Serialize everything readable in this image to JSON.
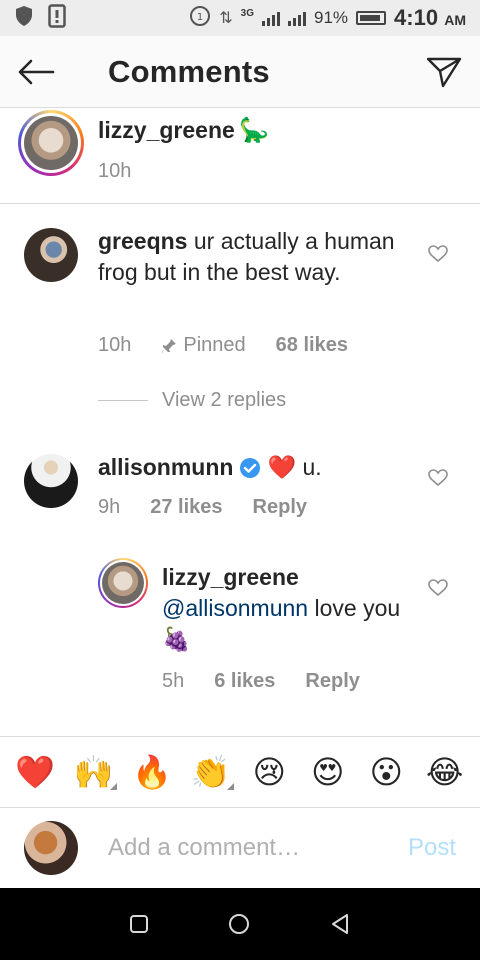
{
  "status_bar": {
    "battery": "91%",
    "time": "4:10",
    "ampm": "AM",
    "network": "3G"
  },
  "header": {
    "title": "Comments"
  },
  "caption": {
    "username": "lizzy_greene",
    "emoji": "🦕",
    "time": "10h"
  },
  "comments": [
    {
      "username": "greeqns",
      "text": " ur actually a human frog but in the best way.",
      "time": "10h",
      "pinned": "Pinned",
      "likes": "68 likes"
    },
    {
      "username": "allisonmunn",
      "text": " ❤️ u.",
      "time": "9h",
      "likes": "27 likes",
      "reply": "Reply"
    },
    {
      "username": "lizzy_greene",
      "mention": "@allisonmunn",
      "text": " love you🍇",
      "time": "5h",
      "likes": "6 likes",
      "reply": "Reply"
    }
  ],
  "view_replies": "View 2 replies",
  "emoji_bar": [
    "❤️",
    "🙌",
    "🔥",
    "👏",
    "😢",
    "😍",
    "😮",
    "😂"
  ],
  "composer": {
    "placeholder": "Add a comment…",
    "post": "Post"
  },
  "colors": {
    "link": "#003569",
    "post_disabled": "#b2dffc",
    "verified": "#3897f0",
    "heart": "#ed4956"
  }
}
